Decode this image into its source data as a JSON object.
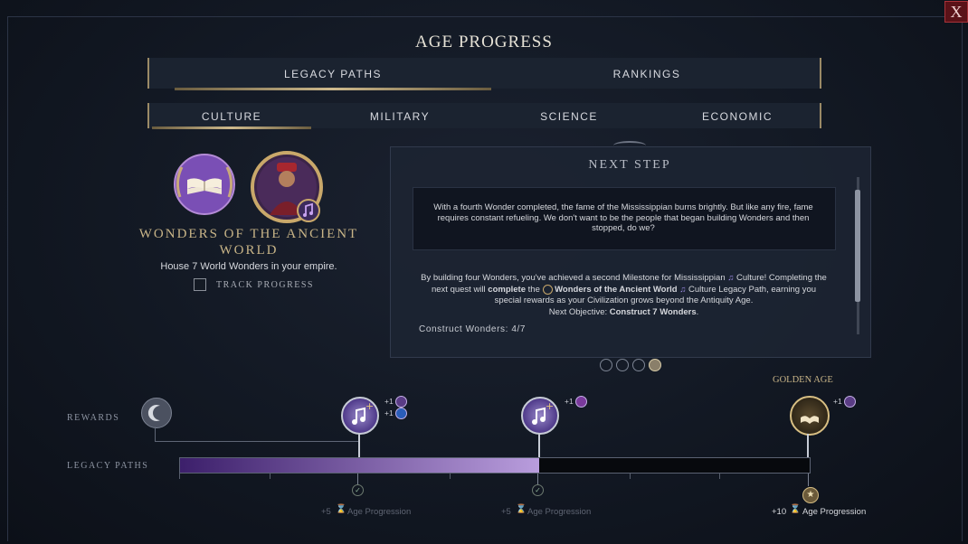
{
  "window": {
    "title": "AGE PROGRESS",
    "close_label": "X"
  },
  "main_tabs": [
    {
      "label": "LEGACY PATHS",
      "selected": true
    },
    {
      "label": "RANKINGS",
      "selected": false
    }
  ],
  "sub_tabs": [
    {
      "label": "CULTURE",
      "selected": true
    },
    {
      "label": "MILITARY",
      "selected": false
    },
    {
      "label": "SCIENCE",
      "selected": false
    },
    {
      "label": "ECONOMIC",
      "selected": false
    }
  ],
  "quest": {
    "title_line1": "WONDERS OF THE ANCIENT",
    "title_line2": "WORLD",
    "description": "House 7 World Wonders in your empire.",
    "track_label": "TRACK PROGRESS",
    "track_checked": false,
    "icons": [
      "book-laurel-icon",
      "leader-portrait",
      "culture-note-icon"
    ]
  },
  "next_step": {
    "header": "NEXT STEP",
    "quote": "With a fourth Wonder completed, the fame of the Mississippian burns brightly. But like any fire, fame requires constant refueling. We don't want to be the people that began building Wonders and then stopped, do we?",
    "body_1": "By building four Wonders, you've achieved a second Milestone for Mississippian",
    "body_2": "Culture! Completing the",
    "body_3": "next quest will",
    "body_4": "complete",
    "body_5": "the",
    "body_6": "Wonders of the Ancient World",
    "body_7": "Culture Legacy Path, earning you",
    "body_8": "special rewards as your Civilization grows beyond the Antiquity Age.",
    "objective_prefix": "Next Objective:",
    "objective": "Construct 7 Wonders",
    "objective_suffix": ".",
    "progress_label": "Construct Wonders: 4/7",
    "progress_current": 4,
    "progress_total": 7
  },
  "pager": {
    "pages": 4,
    "current": 4
  },
  "track": {
    "rewards_label": "REWARDS",
    "legacy_label": "LEGACY PATHS",
    "progress_fraction": 0.57,
    "golden_age_label": "GOLDEN AGE",
    "rewards": [
      {
        "line1": "+1",
        "line2": "+1"
      },
      {
        "line1": "+1"
      },
      {
        "line1": "+1"
      }
    ],
    "milestones": [
      {
        "plus": "+5",
        "label": "Age Progression"
      },
      {
        "plus": "+5",
        "label": "Age Progression"
      },
      {
        "plus": "+10",
        "label": "Age Progression"
      }
    ]
  },
  "colors": {
    "accent_gold": "#c8b487",
    "culture_purple": "#7a4fb5",
    "bar_fill_end": "#b99ddd"
  }
}
